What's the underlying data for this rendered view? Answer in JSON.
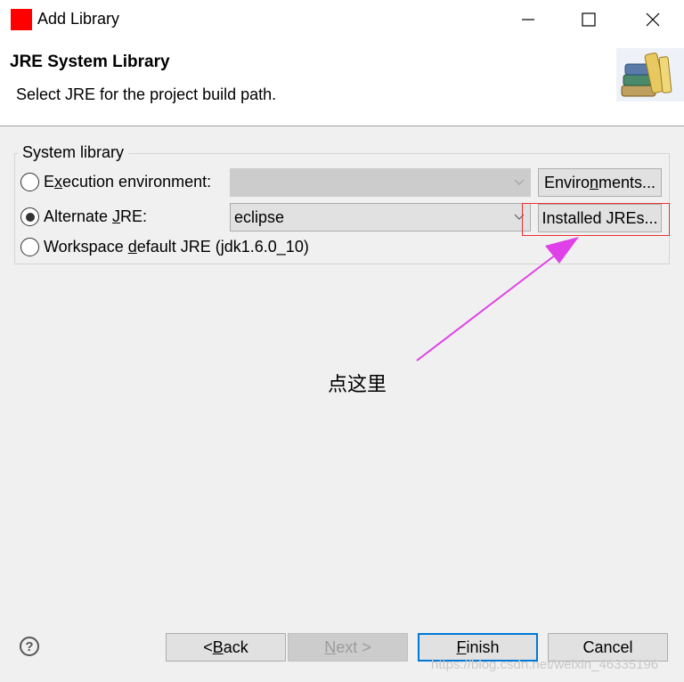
{
  "window": {
    "title": "Add Library",
    "minimize_icon": "minimize-icon",
    "maximize_icon": "maximize-icon",
    "close_icon": "close-icon"
  },
  "banner": {
    "title": "JRE System Library",
    "description": "Select JRE for the project build path.",
    "image": "library-books-icon"
  },
  "group": {
    "label": "System library",
    "execution": {
      "pre": "E",
      "ul": "x",
      "post": "ecution environment:",
      "selected": false,
      "combo_value": "",
      "button_pre": "Enviro",
      "button_ul": "n",
      "button_post": "ments..."
    },
    "alternate": {
      "pre": "Alternate ",
      "ul": "J",
      "post": "RE:",
      "selected": true,
      "combo_value": "eclipse",
      "button_label": "Installed JREs..."
    },
    "workspace": {
      "pre": "Workspace ",
      "ul": "d",
      "post": "efault JRE (jdk1.6.0_10)",
      "selected": false
    }
  },
  "annotation": {
    "text": "点这里",
    "arrow_color": "#e040e8",
    "highlight_color": "#e83030"
  },
  "footer": {
    "help_glyph": "?",
    "back": {
      "pre": "< ",
      "ul": "B",
      "post": "ack"
    },
    "next": {
      "pre": "",
      "ul": "N",
      "post": "ext >"
    },
    "finish": {
      "pre": "",
      "ul": "F",
      "post": "inish"
    },
    "cancel": "Cancel"
  },
  "watermark": "https://blog.csdn.net/weixin_46335196"
}
